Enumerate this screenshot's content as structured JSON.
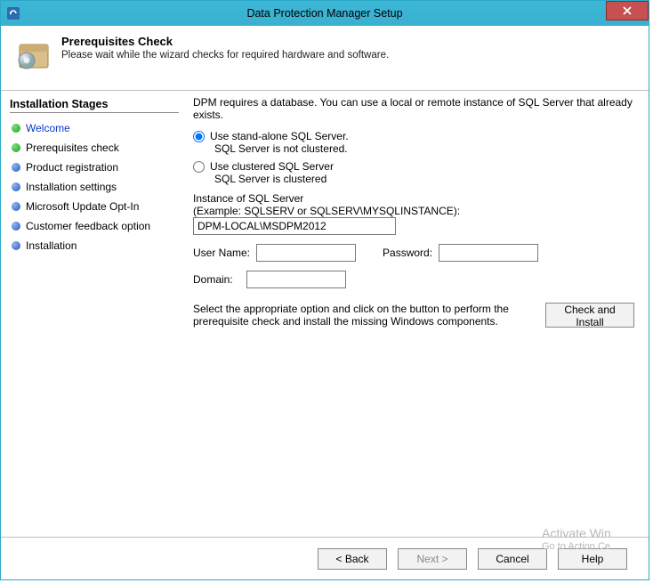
{
  "window": {
    "title": "Data Protection Manager Setup"
  },
  "header": {
    "title": "Prerequisites Check",
    "sub": "Please wait while the wizard checks for required hardware and software."
  },
  "sidebar": {
    "header": "Installation Stages",
    "stages": [
      {
        "label": "Welcome",
        "dot": "green",
        "link": true
      },
      {
        "label": "Prerequisites check",
        "dot": "green",
        "link": false
      },
      {
        "label": "Product registration",
        "dot": "blue",
        "link": false
      },
      {
        "label": "Installation settings",
        "dot": "blue",
        "link": false
      },
      {
        "label": "Microsoft Update Opt-In",
        "dot": "blue",
        "link": false
      },
      {
        "label": "Customer feedback option",
        "dot": "blue",
        "link": false
      },
      {
        "label": "Installation",
        "dot": "blue",
        "link": false
      }
    ]
  },
  "main": {
    "intro": "DPM requires a database. You can use a local or remote instance of SQL Server that already exists.",
    "opt1": {
      "label": "Use stand-alone SQL Server.",
      "sub": "SQL Server is not clustered.",
      "checked": true
    },
    "opt2": {
      "label": "Use clustered SQL Server",
      "sub": "SQL Server is clustered",
      "checked": false
    },
    "instance_label": "Instance of SQL Server",
    "instance_example": "(Example: SQLSERV or SQLSERV\\MYSQLINSTANCE):",
    "instance_value": "DPM-LOCAL\\MSDPM2012",
    "user_label": "User Name:",
    "user_value": "",
    "password_label": "Password:",
    "password_value": "",
    "domain_label": "Domain:",
    "domain_value": "",
    "check_text": "Select the appropriate option and click on the button  to perform the prerequisite check and install the missing Windows components.",
    "check_button": "Check and Install"
  },
  "footer": {
    "back": "< Back",
    "next": "Next >",
    "cancel": "Cancel",
    "help": "Help"
  },
  "watermark": {
    "line1": "Activate Win",
    "line2": "Go to Action Ce"
  }
}
